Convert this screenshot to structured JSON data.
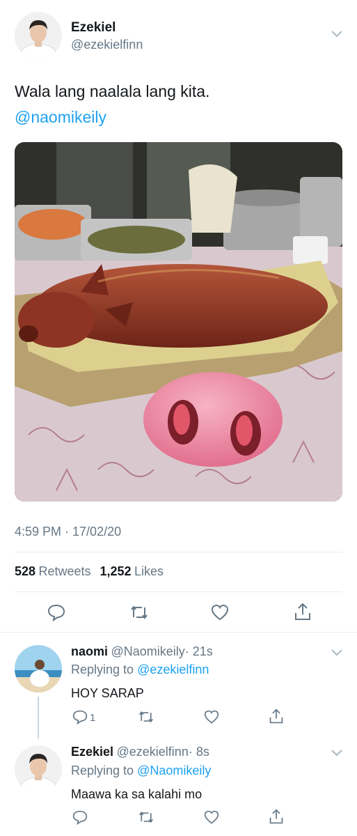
{
  "tweet": {
    "author_name": "Ezekiel",
    "author_handle": "@ezekielfinn",
    "text": "Wala lang naalala lang kita.",
    "mention": "@naomikeily",
    "timestamp": "4:59 PM · 17/02/20",
    "retweets": "528",
    "retweets_label": "Retweets",
    "likes": "1,252",
    "likes_label": "Likes",
    "image_desc": "lechon roast pig on table with pig nose emoji"
  },
  "replies": [
    {
      "name": "naomi",
      "handle": "@Naomikeily",
      "age": "· 21s",
      "replying_prefix": "Replying to",
      "replying_to": "@ezekielfinn",
      "text": "HOY SARAP",
      "reply_count": "1"
    },
    {
      "name": "Ezekiel",
      "handle": "@ezekielfinn",
      "age": "· 8s",
      "replying_prefix": "Replying to",
      "replying_to": "@Naomikeily",
      "text": "Maawa ka sa kalahi mo",
      "reply_count": ""
    }
  ],
  "icons": [
    "chevron-down-icon",
    "reply-icon",
    "retweet-icon",
    "like-icon",
    "share-icon"
  ],
  "colors": {
    "accent": "#1da1f2",
    "muted": "#657786",
    "text": "#14171a",
    "divider": "#e6ecf0"
  }
}
